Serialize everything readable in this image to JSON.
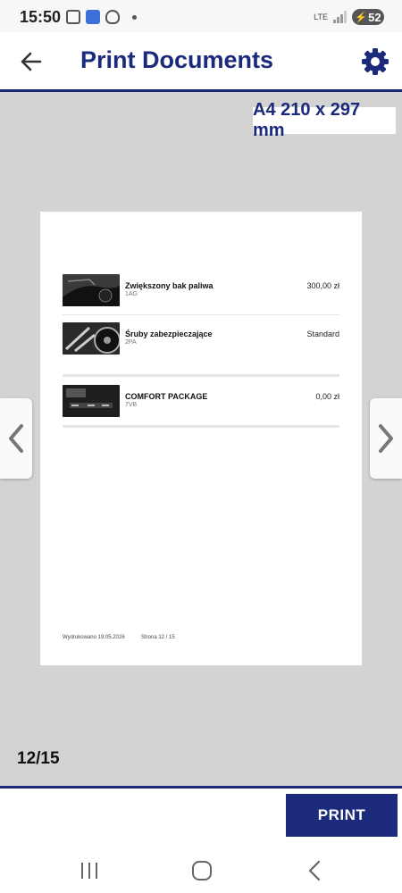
{
  "status_bar": {
    "time": "15:50",
    "network": "LTE",
    "battery": "52"
  },
  "app_bar": {
    "title": "Print Documents"
  },
  "viewer": {
    "paper_size": "A4 210 x 297 mm",
    "page_counter": "12/15",
    "document": {
      "items": [
        {
          "name": "Zwiększony bak paliwa",
          "code": "1AG",
          "price": "300,00 zł"
        },
        {
          "name": "Śruby zabezpieczające",
          "code": "2PA",
          "price": "Standard"
        },
        {
          "name": "COMFORT PACKAGE",
          "code": "7VB",
          "price": "0,00 zł"
        }
      ],
      "footer_printed": "Wydrukowano 19.05.2026",
      "footer_page": "Strona 12 / 15"
    }
  },
  "bottom_bar": {
    "print_label": "PRINT"
  },
  "colors": {
    "accent": "#1c2a7c",
    "viewer_bg": "#d3d3d3"
  },
  "icons": {
    "back": "arrow-left-icon",
    "settings": "gear-icon",
    "prev": "chevron-left-icon",
    "next": "chevron-right-icon"
  }
}
